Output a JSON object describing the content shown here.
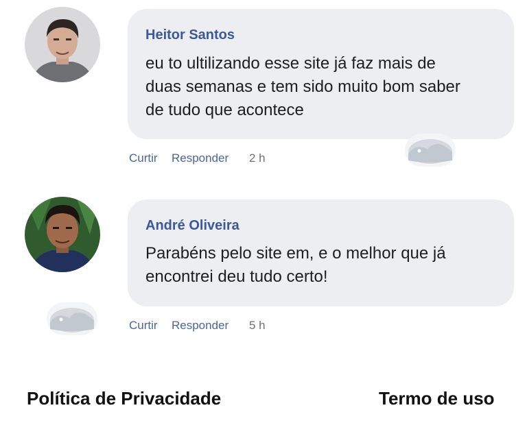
{
  "comments": [
    {
      "author": "Heitor Santos",
      "text": "eu to ultilizando esse site já faz mais de\nduas semanas e tem sido muito bom saber\nde tudo que acontece",
      "like_label": "Curtir",
      "reply_label": "Responder",
      "time": "2 h",
      "avatar_icon": "avatar-photo-icon"
    },
    {
      "author": "André Oliveira",
      "text": "Parabéns pelo site em, e o melhor que já\nencontrei deu tudo certo!",
      "like_label": "Curtir",
      "reply_label": "Responder",
      "time": "5 h",
      "avatar_icon": "avatar-photo-icon"
    }
  ],
  "footer": {
    "privacy_label": "Política de Privacidade",
    "terms_label": "Termo de uso"
  },
  "colors": {
    "author_name": "#3b5998",
    "bubble_background": "#eceef1",
    "action_link": "#4a64a0"
  }
}
